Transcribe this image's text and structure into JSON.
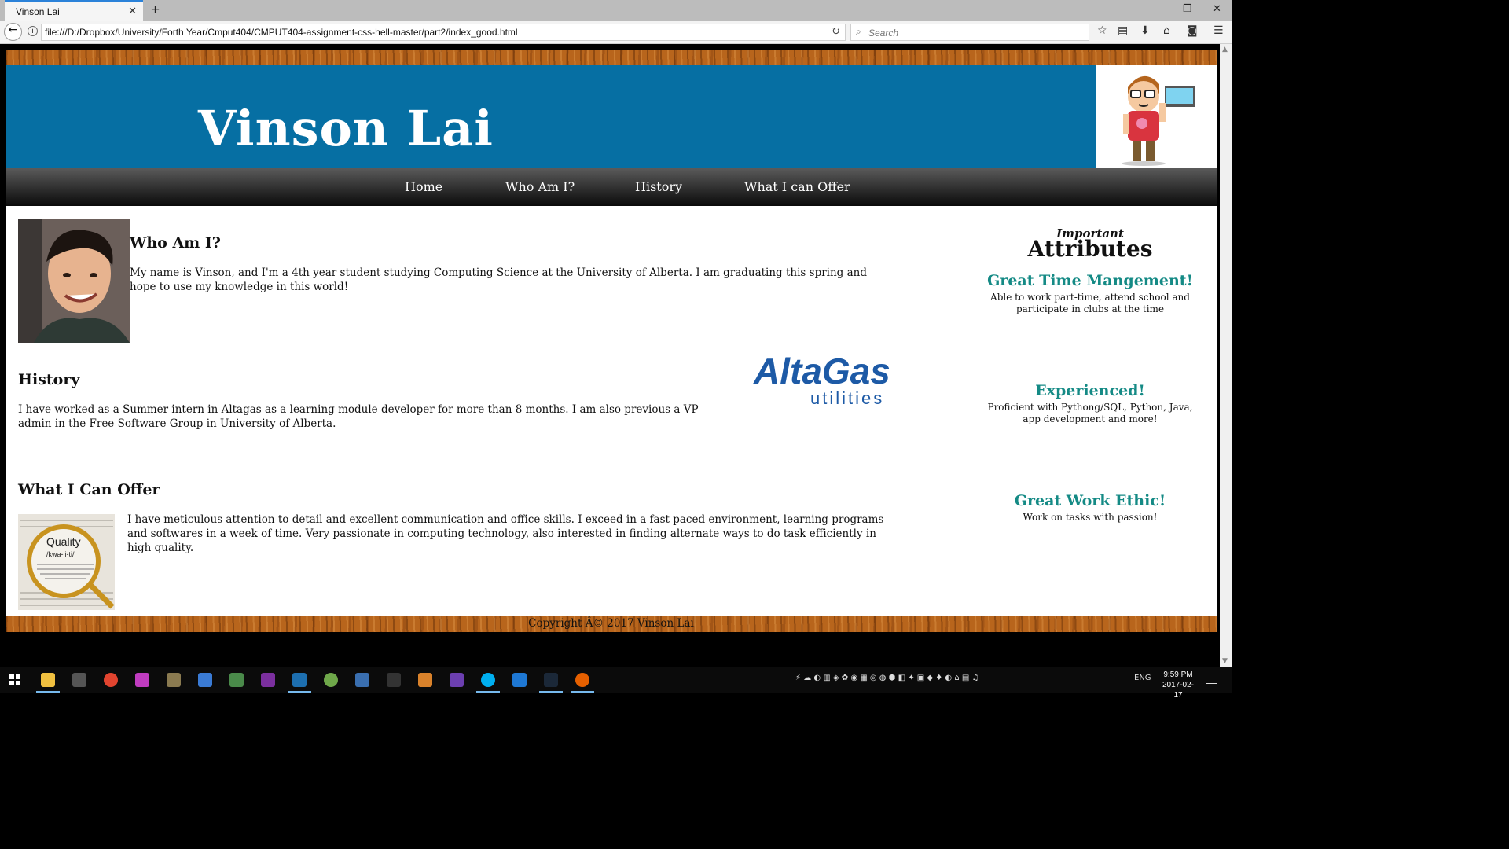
{
  "browser": {
    "tab_title": "Vinson Lai",
    "tab_close": "✕",
    "new_tab": "+",
    "url": "file:///D:/Dropbox/University/Forth Year/Cmput404/CMPUT404-assignment-css-hell-master/part2/index_good.html",
    "search_placeholder": "Search",
    "window_controls": {
      "minimize": "–",
      "restore": "❐",
      "close": "✕"
    }
  },
  "site": {
    "title": "Vinson Lai",
    "nav": [
      "Home",
      "Who Am I?",
      "History",
      "What I can Offer"
    ]
  },
  "sections": {
    "who": {
      "heading": "Who Am I?",
      "text": "My name is Vinson, and I'm a 4th year student studying Computing Science at the University of Alberta. I am graduating this spring and hope to use my knowledge in this world!"
    },
    "history": {
      "heading": "History",
      "text": "I have worked as a Summer intern in Altagas as a learning module developer for more than 8 months. I am also previous a VP admin in the Free Software Group in University of Alberta.",
      "logo_main": "AltaGas",
      "logo_sub": "utilities"
    },
    "offer": {
      "heading": "What I Can Offer",
      "text": "I have meticulous attention to detail and excellent communication and office skills. I exceed in a fast paced environment, learning programs and softwares in a week of time. Very passionate in computing technology, also interested in finding alternate ways to do task efficiently in high quality.",
      "image_word": "Quality",
      "image_phonetic": "/kwa-li-ti/"
    }
  },
  "aside": {
    "small_heading": "Important",
    "big_heading": "Attributes",
    "items": [
      {
        "title": "Great Time Mangement!",
        "desc": "Able to work part-time, attend school and participate in clubs at the time"
      },
      {
        "title": "Experienced!",
        "desc": "Proficient with Pythong/SQL, Python, Java, app development and more!"
      },
      {
        "title": "Great Work Ethic!",
        "desc": "Work on tasks with passion!"
      }
    ]
  },
  "footer": {
    "copyright": "Copyright Â© 2017 Vinson Lai"
  },
  "taskbar": {
    "language": "ENG",
    "time": "9:59 PM",
    "date": "2017-02-17"
  },
  "colors": {
    "header_blue": "#066fa3",
    "attribute_teal": "#148a85",
    "wood": "#b8651c"
  }
}
